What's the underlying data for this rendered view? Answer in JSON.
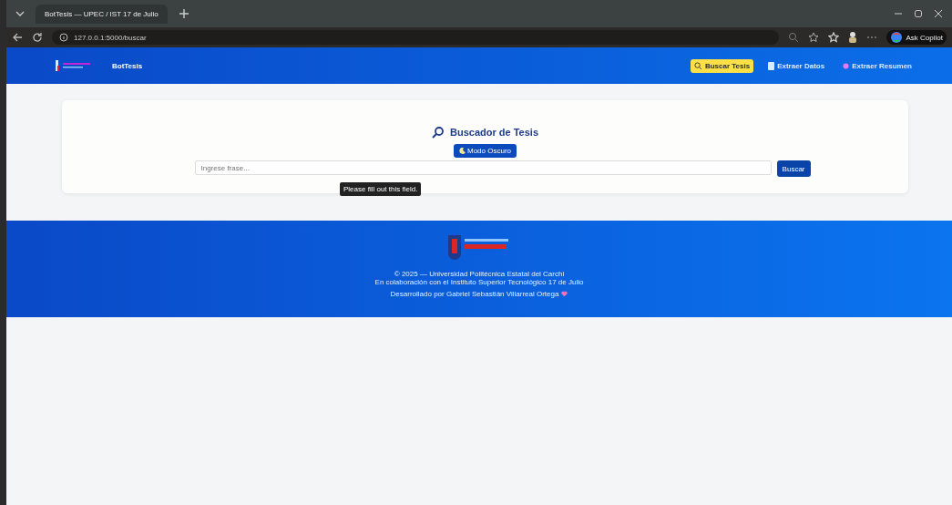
{
  "browser": {
    "tabs": [
      {
        "title": "BotTesis — UPEC / IST 17 de Julio",
        "selected": true
      }
    ],
    "address": "127.0.0.1:5000/buscar",
    "copilot": "Ask Copilot"
  },
  "navbar": {
    "brand": "BotTesis",
    "items": [
      {
        "label": "Buscar Tesis",
        "selected": true,
        "kind": "search"
      },
      {
        "label": "Extraer Datos",
        "selected": false,
        "kind": "doc"
      },
      {
        "label": "Extraer Resumen",
        "selected": false,
        "kind": "dot"
      }
    ]
  },
  "search_card": {
    "title": "Buscador de Tesis",
    "mode_button": "Modo Oscuro",
    "placeholder": "Ingrese frase...",
    "button": "Buscar",
    "tooltip": "Please fill out this field."
  },
  "footer": {
    "lines": [
      "© 2025 — Universidad Politécnica Estatal del Carchi",
      "En colaboración con el Instituto Superior Tecnológico 17 de Julio"
    ],
    "credit": "Desarrollado por Gabriel Sebastián Villarreal Ortega"
  }
}
